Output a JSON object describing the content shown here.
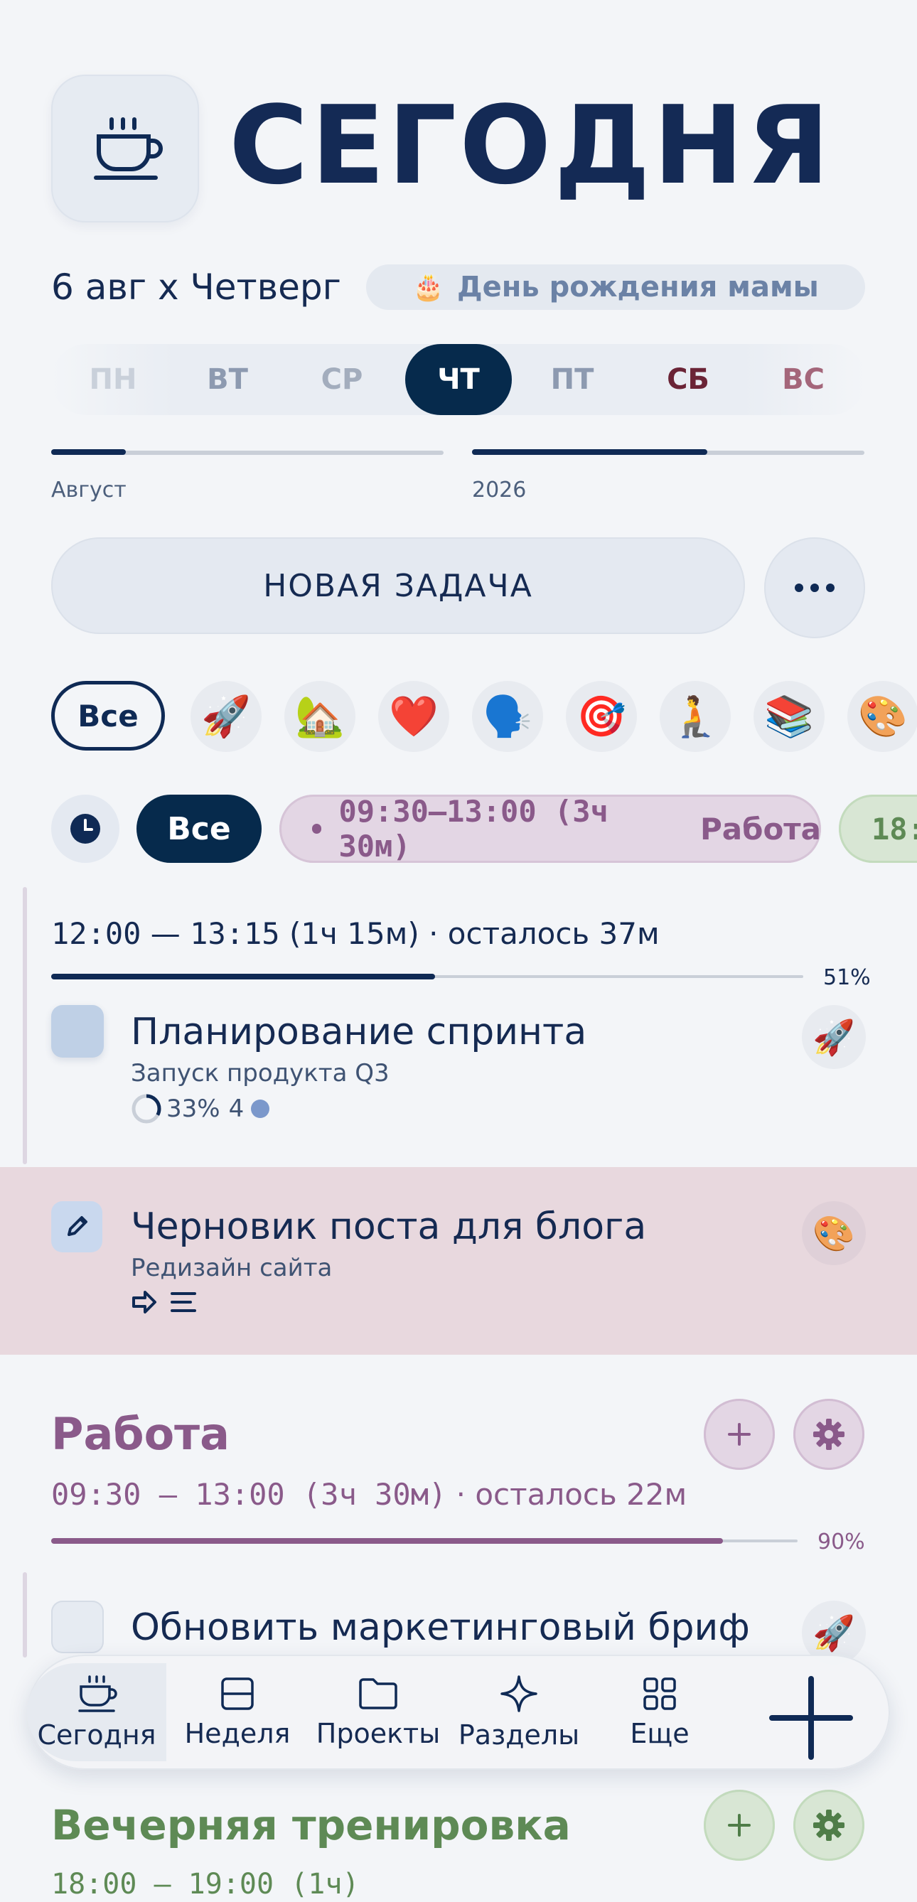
{
  "header": {
    "title": "СЕГОДНЯ",
    "app_icon": "coffee-cup-icon"
  },
  "date": {
    "label": "6 авг х Четверг",
    "event": "День рождения мамы",
    "event_icon": "🎂"
  },
  "week": {
    "days": [
      {
        "label": "ПН",
        "color": "#c9d0da"
      },
      {
        "label": "ВТ",
        "color": "#8d9ab0"
      },
      {
        "label": "СР",
        "color": "#a3adbd"
      },
      {
        "label": "ЧТ",
        "color": "#ffffff"
      },
      {
        "label": "ПТ",
        "color": "#8d9ab0"
      },
      {
        "label": "СБ",
        "color": "#6b2436"
      },
      {
        "label": "ВС",
        "color": "#a4667a"
      }
    ],
    "active_index": 3
  },
  "progress": {
    "month": {
      "label": "Август",
      "fraction": 0.19
    },
    "year": {
      "label": "2026",
      "fraction": 0.6
    }
  },
  "actions": {
    "new_task": "НОВАЯ ЗАДАЧА",
    "more_icon": "ellipsis-icon"
  },
  "categories": {
    "all_label": "Все",
    "items": [
      "🚀",
      "🏡",
      "❤️",
      "🗣️",
      "🎯",
      "🧎",
      "📚",
      "🎨"
    ]
  },
  "time_filters": {
    "clock_icon": "clock-icon",
    "all_label": "Все",
    "chips": [
      {
        "time": "09:30–13:00 (3ч 30м)",
        "name": "Работа"
      },
      {
        "time": "18:"
      }
    ]
  },
  "current_block": {
    "time": "12:00",
    "dash": "—",
    "end": "13:15",
    "duration": "(1ч 15м)",
    "remaining": "· осталось 37м",
    "percent_label": "51%",
    "fraction": 0.51
  },
  "tasks": [
    {
      "title": "Планирование спринта",
      "subtitle": "Запуск продукта Q3",
      "progress_label": "33%",
      "count": "4",
      "progress": 0.33,
      "emoji": "🚀"
    },
    {
      "title": "Черновик поста для блога",
      "subtitle": "Редизайн сайта",
      "emoji": "🎨"
    }
  ],
  "work_section": {
    "title": "Работа",
    "range": "09:30 — 13:00 (3ч 30м)",
    "remaining": "· осталось 22м",
    "percent_label": "90%",
    "fraction": 0.9,
    "color": "#8a5a8a",
    "task": {
      "title": "Обновить маркетинговый бриф",
      "emoji": "🚀"
    }
  },
  "evening_section": {
    "title": "Вечерняя тренировка",
    "range": "18:00 — 19:00 (1ч)",
    "color": "#5e8a55"
  },
  "nav": {
    "items": [
      {
        "label": "Сегодня",
        "icon": "coffee-cup-icon"
      },
      {
        "label": "Неделя",
        "icon": "week-layout-icon"
      },
      {
        "label": "Проекты",
        "icon": "folder-icon"
      },
      {
        "label": "Разделы",
        "icon": "sparkle-icon"
      },
      {
        "label": "Еще",
        "icon": "grid-icon"
      }
    ],
    "add_icon": "plus-icon"
  }
}
